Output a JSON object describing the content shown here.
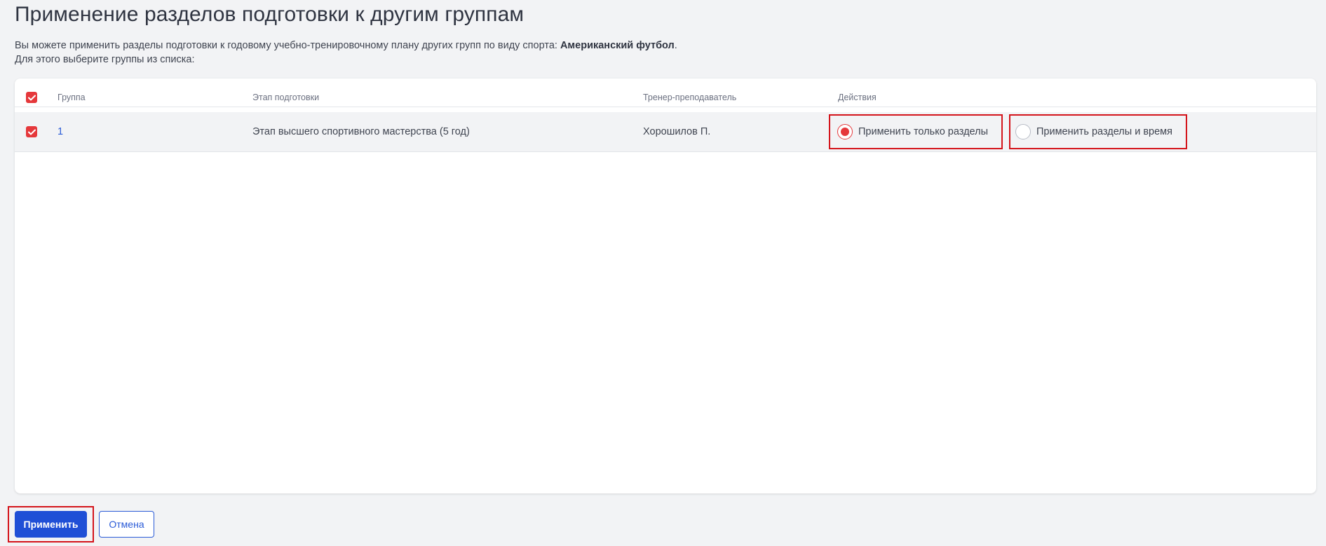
{
  "page": {
    "title": "Применение разделов подготовки к другим группам",
    "description_line1_prefix": "Вы можете применить разделы подготовки к годовому учебно-тренировочному плану других групп по виду спорта: ",
    "sport": "Американский футбол",
    "description_line1_suffix": ".",
    "description_line2": "Для этого выберите группы из списка:"
  },
  "table": {
    "select_all_checked": true,
    "columns": {
      "group": "Группа",
      "stage": "Этап подготовки",
      "coach": "Тренер-преподаватель",
      "actions": "Действия"
    },
    "rows": [
      {
        "checked": true,
        "group": "1",
        "stage": "Этап высшего спортивного мастерства (5 год)",
        "coach": "Хорошилов П.",
        "actions": [
          {
            "label": "Применить только разделы",
            "selected": true
          },
          {
            "label": "Применить разделы и время",
            "selected": false
          }
        ]
      }
    ]
  },
  "buttons": {
    "apply": "Применить",
    "cancel": "Отмена"
  },
  "colors": {
    "accent_red": "#e5383b",
    "highlight_red": "#d4141b",
    "primary_blue": "#1f4fd6",
    "link_blue": "#2a5bd7"
  }
}
